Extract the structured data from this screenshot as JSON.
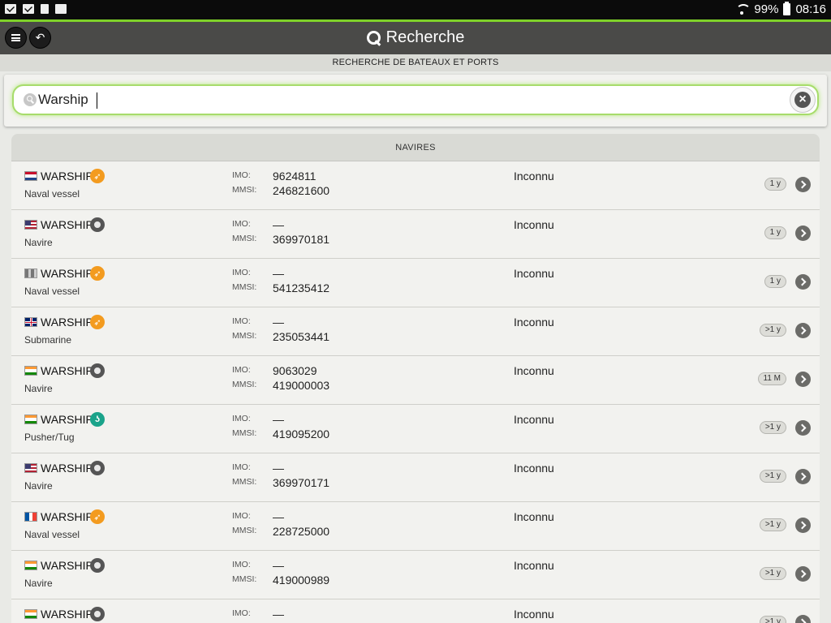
{
  "status_bar": {
    "battery": "99%",
    "time": "08:16"
  },
  "header": {
    "title": "Recherche"
  },
  "subheader": "RECHERCHE DE BATEAUX ET PORTS",
  "search": {
    "value": "Warship"
  },
  "section_title": "NAVIRES",
  "labels": {
    "imo": "IMO:",
    "mmsi": "MMSI:"
  },
  "colors": {
    "accent": "#7fd12a",
    "naval": "#f39b1f",
    "tug": "#1aa38a",
    "header": "#4a4a48"
  },
  "vessels": [
    {
      "name": "WARSHIP",
      "type": "Naval vessel",
      "flag": "netherlands",
      "type_icon": "naval-vessel-icon",
      "imo": "9624811",
      "mmsi": "246821600",
      "destination": "Inconnu",
      "age": "1 y"
    },
    {
      "name": "WARSHIP",
      "type": "Navire",
      "flag": "united-states",
      "type_icon": "unknown-ship-icon",
      "imo": "—",
      "mmsi": "369970181",
      "destination": "Inconnu",
      "age": "1 y"
    },
    {
      "name": "WARSHIP",
      "type": "Naval vessel",
      "flag": "grey-striped",
      "type_icon": "naval-vessel-icon",
      "imo": "—",
      "mmsi": "541235412",
      "destination": "Inconnu",
      "age": "1 y"
    },
    {
      "name": "WARSHIP",
      "type": "Submarine",
      "flag": "united-kingdom",
      "type_icon": "naval-vessel-icon",
      "imo": "—",
      "mmsi": "235053441",
      "destination": "Inconnu",
      "age": ">1 y"
    },
    {
      "name": "WARSHIP",
      "type": "Navire",
      "flag": "india",
      "type_icon": "unknown-ship-icon",
      "imo": "9063029",
      "mmsi": "419000003",
      "destination": "Inconnu",
      "age": "11 M"
    },
    {
      "name": "WARSHIP",
      "type": "Pusher/Tug",
      "flag": "india",
      "type_icon": "tug-icon",
      "imo": "—",
      "mmsi": "419095200",
      "destination": "Inconnu",
      "age": ">1 y"
    },
    {
      "name": "WARSHIP",
      "type": "Navire",
      "flag": "united-states",
      "type_icon": "unknown-ship-icon",
      "imo": "—",
      "mmsi": "369970171",
      "destination": "Inconnu",
      "age": ">1 y"
    },
    {
      "name": "WARSHIP",
      "type": "Naval vessel",
      "flag": "france",
      "type_icon": "naval-vessel-icon",
      "imo": "—",
      "mmsi": "228725000",
      "destination": "Inconnu",
      "age": ">1 y"
    },
    {
      "name": "WARSHIP",
      "type": "Navire",
      "flag": "india",
      "type_icon": "unknown-ship-icon",
      "imo": "—",
      "mmsi": "419000989",
      "destination": "Inconnu",
      "age": ">1 y"
    },
    {
      "name": "WARSHIP",
      "type": "",
      "flag": "india",
      "type_icon": "unknown-ship-icon",
      "imo": "—",
      "mmsi": "",
      "destination": "Inconnu",
      "age": ">1 y"
    }
  ]
}
